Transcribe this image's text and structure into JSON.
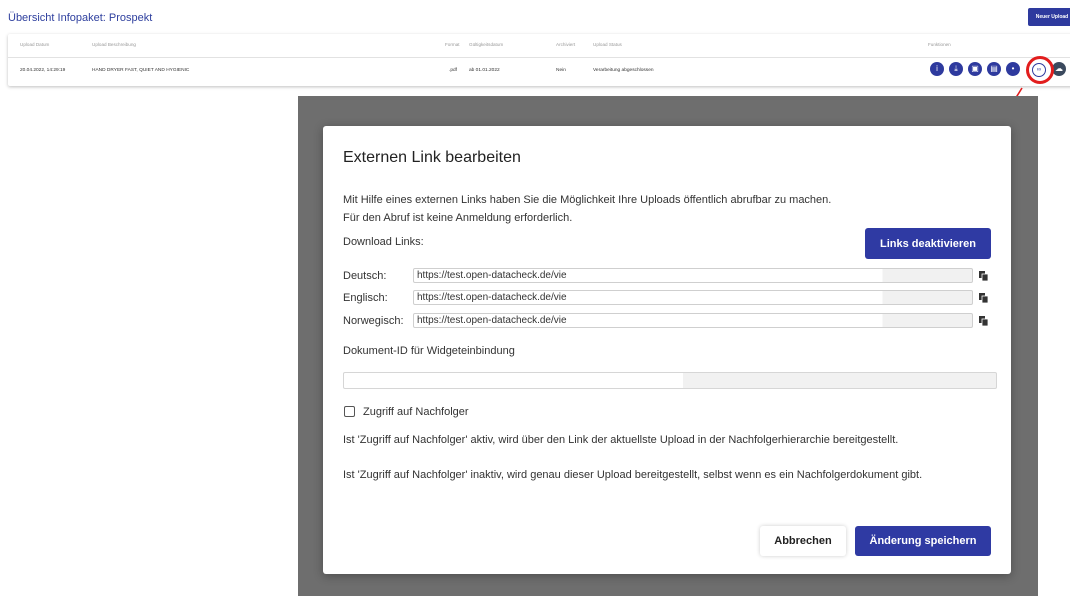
{
  "header": {
    "title": "Übersicht Infopaket: Prospekt",
    "new_upload_label": "Neuer Upload"
  },
  "table": {
    "columns": [
      "Upload Datum",
      "Upload Beschreibung",
      "Format",
      "Gültigkeitsdatum",
      "Archiviert",
      "Upload Status",
      "Funktionen"
    ],
    "row": {
      "date": "20.04.2022, 14:29:19",
      "description": "HAND DRYER FAST, QUIET AND HYGIENIC",
      "format": ".pdf",
      "validity": "ab 01.01.2022",
      "archived": "Nein",
      "status": "Verarbeitung abgeschlossen"
    },
    "function_icons": [
      "info-icon",
      "download-icon",
      "archive-icon",
      "document-icon",
      "delete-icon",
      "external-link-icon",
      "cloud-icon"
    ]
  },
  "modal": {
    "title": "Externen Link bearbeiten",
    "description_line1": "Mit Hilfe eines externen Links haben Sie die Möglichkeit Ihre Uploads öffentlich abrufbar zu machen.",
    "description_line2": "Für den Abruf ist keine Anmeldung erforderlich.",
    "download_links_label": "Download Links:",
    "deactivate_button": "Links deaktivieren",
    "links": [
      {
        "label": "Deutsch:",
        "value": "https://test.open-datacheck.de/vie"
      },
      {
        "label": "Englisch:",
        "value": "https://test.open-datacheck.de/vie"
      },
      {
        "label": "Norwegisch:",
        "value": "https://test.open-datacheck.de/vie"
      }
    ],
    "doc_id_label": "Dokument-ID für Widgeteinbindung",
    "doc_id_value": "",
    "successor_checkbox_label": "Zugriff auf Nachfolger",
    "successor_checked": false,
    "info_active": "Ist 'Zugriff auf Nachfolger' aktiv, wird über den Link der aktuellste Upload in der Nachfolgerhierarchie bereitgestellt.",
    "info_inactive": "Ist 'Zugriff auf Nachfolger' inaktiv, wird genau dieser Upload bereitgestellt, selbst wenn es ein Nachfolgerdokument gibt.",
    "cancel_button": "Abbrechen",
    "save_button": "Änderung speichern"
  },
  "colors": {
    "primary": "#2f3aa3",
    "annotation_red": "#e21d1d",
    "overlay": "#6e6e6e"
  }
}
